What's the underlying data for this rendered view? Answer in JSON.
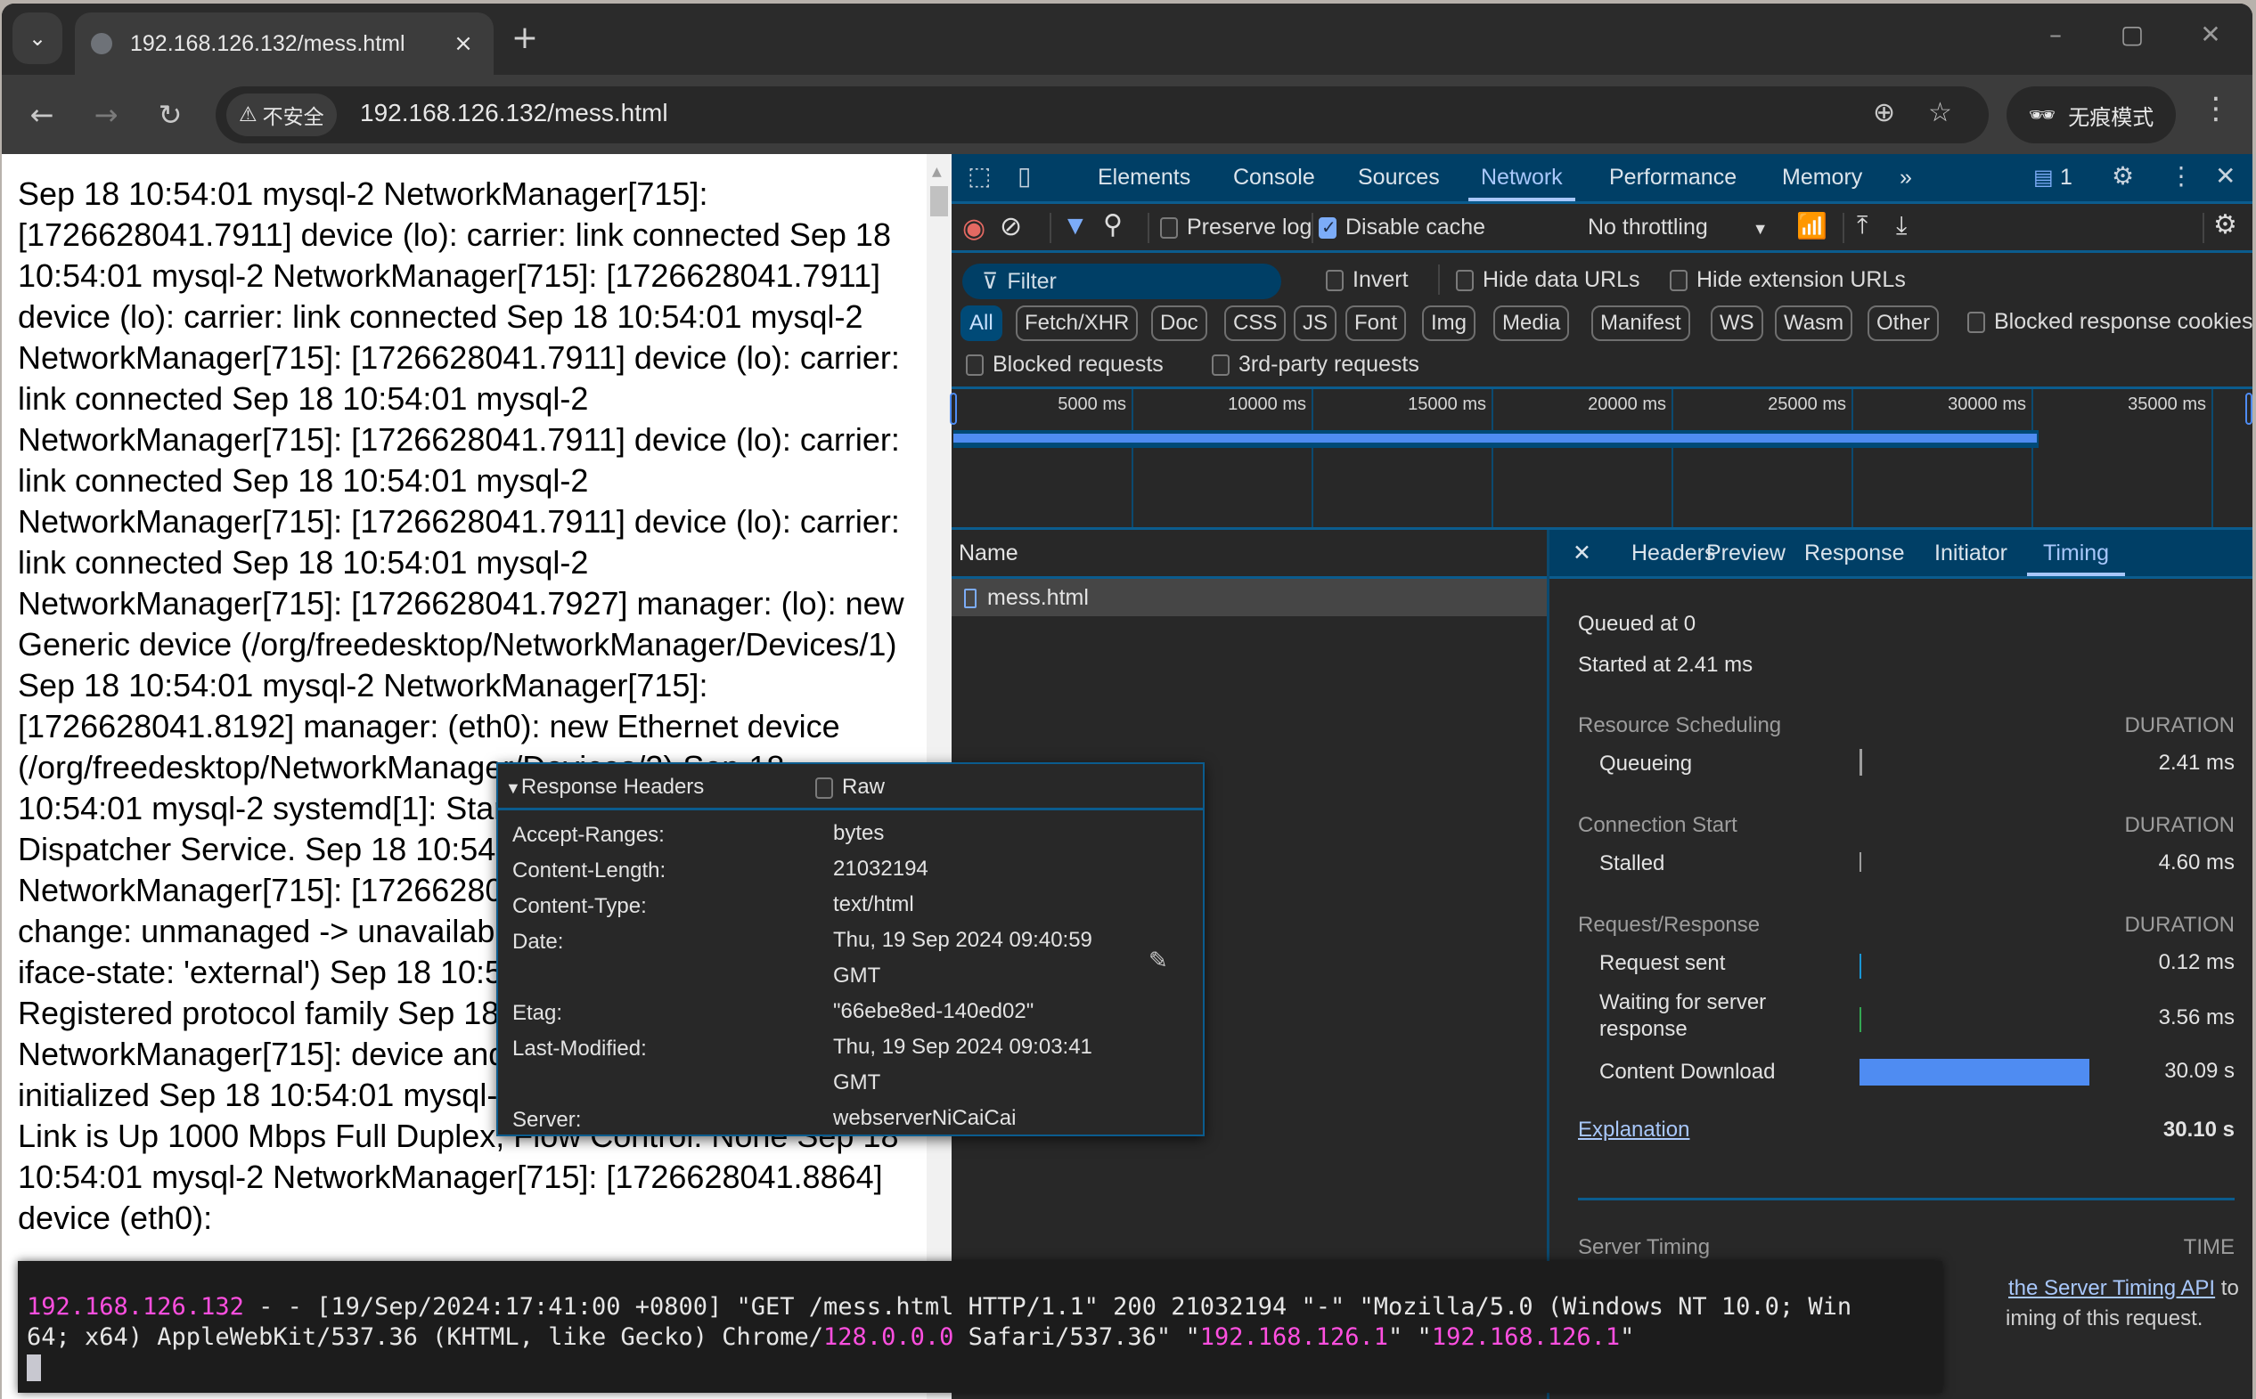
{
  "browser": {
    "tab_title": "192.168.126.132/mess.html",
    "tab_close": "×",
    "new_tab": "+",
    "security_label": "不安全",
    "url": "192.168.126.132/mess.html",
    "incognito_label": "无痕模式",
    "window_controls": [
      "–",
      "▢",
      "✕"
    ]
  },
  "page": {
    "text": "Sep 18 10:54:01 mysql-2 NetworkManager[715]: [1726628041.7911] device (lo): carrier: link connected Sep 18 10:54:01 mysql-2 NetworkManager[715]: [1726628041.7911] device (lo): carrier: link connected Sep 18 10:54:01 mysql-2 NetworkManager[715]: [1726628041.7911] device (lo): carrier: link connected Sep 18 10:54:01 mysql-2 NetworkManager[715]: [1726628041.7911] device (lo): carrier: link connected Sep 18 10:54:01 mysql-2 NetworkManager[715]: [1726628041.7911] device (lo): carrier: link connected Sep 18 10:54:01 mysql-2 NetworkManager[715]: [1726628041.7927] manager: (lo): new Generic device (/org/freedesktop/NetworkManager/Devices/1) Sep 18 10:54:01 mysql-2 NetworkManager[715]: [1726628041.8192] manager: (eth0): new Ethernet device (/org/freedesktop/NetworkManager/Devices/2) Sep 18 10:54:01 mysql-2 systemd[1]: Starting Network Manager Script Dispatcher Service. Sep 18 10:54:01 mysql-2 NetworkManager[715]: [1726628041.8xxx] device (eth0): state change: unmanaged -> unavailable (reason 'managed', sys-iface-state: 'external') Sep 18 10:54:01 mysql-2 kernel: NET: Registered protocol family Sep 18 10:54:01 mysql-2 NetworkManager[715]: device and connection manager initialized Sep 18 10:54:01 mysql-2 kernel: e1000: eth0 NIC Link is Up 1000 Mbps Full Duplex, Flow Control: None Sep 18 10:54:01 mysql-2 NetworkManager[715]: [1726628041.8864] device (eth0):"
  },
  "devtools": {
    "tabs": [
      "Elements",
      "Console",
      "Sources",
      "Network",
      "Performance",
      "Memory"
    ],
    "active_tab": "Network",
    "more_tabs": "»",
    "issues_count": "1",
    "toolbar": {
      "preserve_log": "Preserve log",
      "disable_cache": "Disable cache",
      "throttling": "No throttling"
    },
    "filter": {
      "placeholder": "Filter",
      "invert": "Invert",
      "hide_data_urls": "Hide data URLs",
      "hide_extension_urls": "Hide extension URLs"
    },
    "type_chips": [
      "All",
      "Fetch/XHR",
      "Doc",
      "CSS",
      "JS",
      "Font",
      "Img",
      "Media",
      "Manifest",
      "WS",
      "Wasm",
      "Other"
    ],
    "blocked_response_cookies": "Blocked response cookies",
    "blocked_requests": "Blocked requests",
    "third_party_requests": "3rd-party requests",
    "overview": {
      "ticks": [
        "5000 ms",
        "10000 ms",
        "15000 ms",
        "20000 ms",
        "25000 ms",
        "30000 ms",
        "35000 ms"
      ],
      "request_end_ms": 30100,
      "range_ms": 36200
    },
    "list": {
      "header": "Name",
      "rows": [
        {
          "name": "mess.html"
        }
      ]
    },
    "detail": {
      "close": "✕",
      "tabs": [
        "Headers",
        "Preview",
        "Response",
        "Initiator",
        "Timing"
      ],
      "active_tab": "Timing",
      "queued_at": "Queued at 0",
      "started_at": "Started at 2.41 ms",
      "duration_header": "DURATION",
      "sections": [
        {
          "title": "Resource Scheduling",
          "rows": [
            {
              "name": "Queueing",
              "value": "2.41 ms",
              "color": "#9d9d9d"
            }
          ]
        },
        {
          "title": "Connection Start",
          "rows": [
            {
              "name": "Stalled",
              "value": "4.60 ms",
              "color": "#9d9d9d"
            }
          ]
        },
        {
          "title": "Request/Response",
          "rows": [
            {
              "name": "Request sent",
              "value": "0.12 ms",
              "color": "#1a96d4"
            },
            {
              "name": "Waiting for server response",
              "value": "3.56 ms",
              "color": "#34a853"
            },
            {
              "name": "Content Download",
              "value": "30.09 s",
              "color": "#4f8cf2"
            }
          ]
        }
      ],
      "explanation": "Explanation",
      "total": "30.10 s",
      "server_timing": "Server Timing",
      "time_header": "TIME",
      "server_timing_link": "the Server Timing API",
      "server_timing_tail1": " to",
      "server_timing_tail2": "iming of this request."
    }
  },
  "response_headers_popup": {
    "title": "Response Headers",
    "raw": "Raw",
    "headers": [
      {
        "key": "Accept-Ranges:",
        "value": "bytes"
      },
      {
        "key": "Content-Length:",
        "value": "21032194"
      },
      {
        "key": "Content-Type:",
        "value": "text/html"
      },
      {
        "key": "Date:",
        "value": "Thu, 19 Sep 2024 09:40:59 GMT"
      },
      {
        "key": "Etag:",
        "value": "\"66ebe8ed-140ed02\""
      },
      {
        "key": "Last-Modified:",
        "value": "Thu, 19 Sep 2024 09:03:41 GMT"
      },
      {
        "key": "Server:",
        "value": "webserverNiCaiCai"
      }
    ]
  },
  "terminal": {
    "line1_ip": "192.168.126.132",
    "line1_rest": " - - [19/Sep/2024:17:41:00 +0800] \"GET /mess.html HTTP/1.1\" 200 21032194 \"-\" \"Mozilla/5.0 (Windows NT 10.0; Win",
    "line2_a": "64; x64) AppleWebKit/537.36 (KHTML, like Gecko) Chrome/",
    "line2_ver": "128.0.0.0",
    "line2_b": " Safari/537.36\" \"",
    "line2_ip1": "192.168.126.1",
    "line2_c": "\" \"",
    "line2_ip2": "192.168.126.1",
    "line2_d": "\""
  },
  "colors": {
    "accent": "#a8c7fa",
    "devtools_header": "#003f66",
    "bar_blue": "#4f8cf2",
    "terminal_magenta": "#ff4fe0"
  }
}
